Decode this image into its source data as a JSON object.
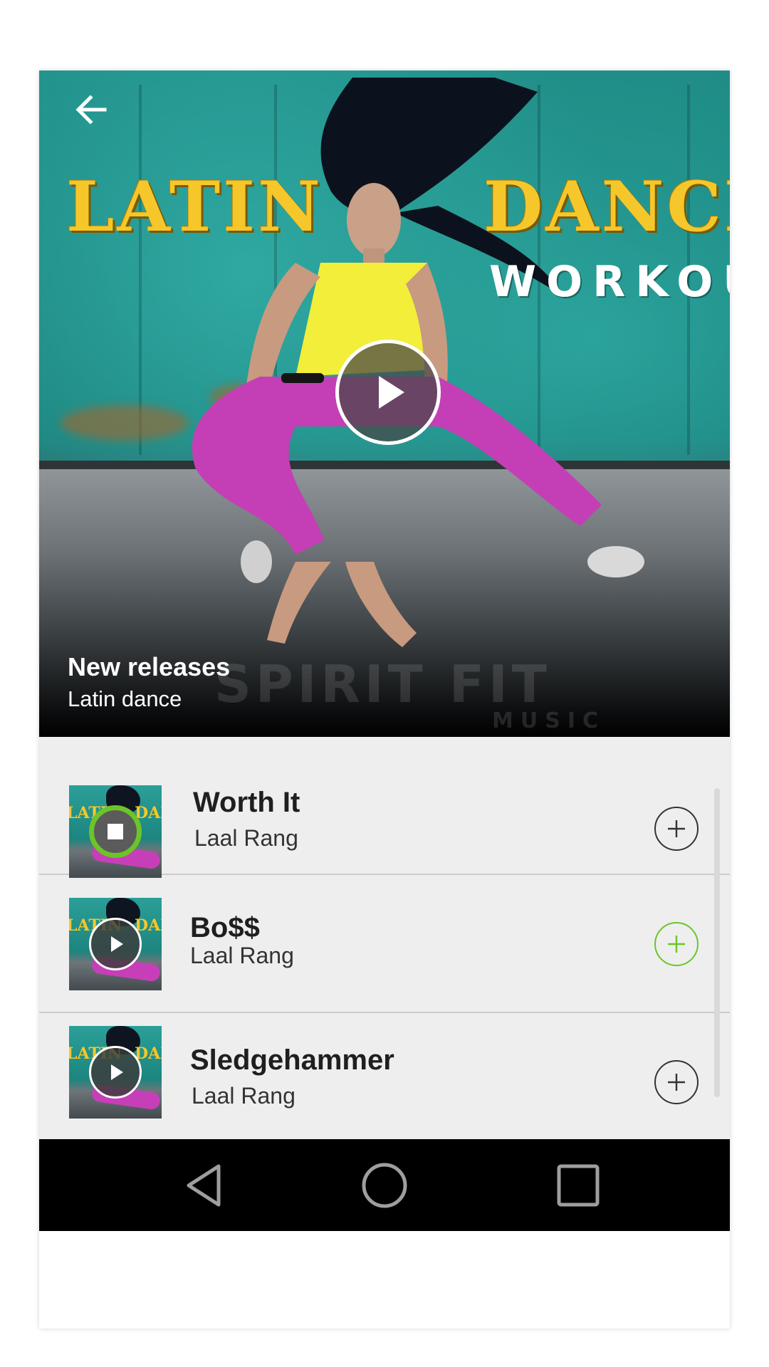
{
  "hero": {
    "artwork": {
      "logo_word1": "LATIN",
      "logo_word2": "DANCE",
      "logo_subtitle": "WORKOUT",
      "watermark": "SPIRIT FIT",
      "watermark_sub": "MUSIC"
    },
    "title": "New releases",
    "subtitle": "Latin dance",
    "back_icon": "arrow-left-icon",
    "play_icon": "play-icon"
  },
  "tracks": [
    {
      "title": "Worth It",
      "artist": "Laal Rang",
      "state": "playing",
      "control_icon": "stop-icon",
      "add_icon": "plus-circle-icon",
      "add_color": "#333333"
    },
    {
      "title": "Bo$$",
      "artist": "Laal Rang",
      "state": "paused",
      "control_icon": "play-icon",
      "add_icon": "plus-circle-icon",
      "add_color": "#6cc429"
    },
    {
      "title": "Sledgehammer",
      "artist": "Laal Rang",
      "state": "paused",
      "control_icon": "play-icon",
      "add_icon": "plus-circle-icon",
      "add_color": "#333333"
    }
  ],
  "nav": {
    "back_icon": "triangle-back-icon",
    "home_icon": "circle-home-icon",
    "recents_icon": "square-recents-icon"
  },
  "colors": {
    "accent": "#6cc429",
    "list_bg": "#eeeeee",
    "nav_bg": "#000000"
  }
}
